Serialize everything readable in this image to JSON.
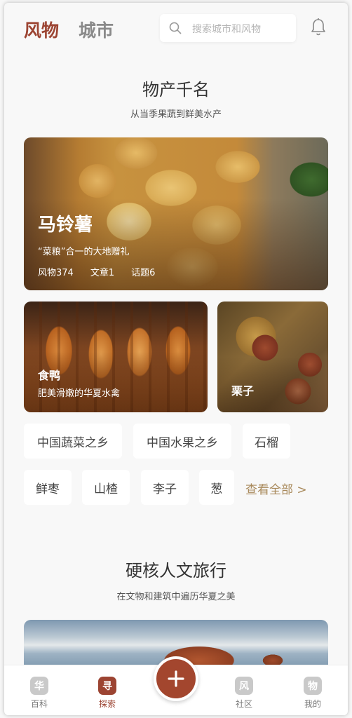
{
  "header": {
    "tab_active": "风物",
    "tab_inactive": "城市",
    "search_placeholder": "搜索城市和风物",
    "icons": {
      "search": "search-icon",
      "notification": "bell-icon"
    }
  },
  "section1": {
    "title": "物产千名",
    "subtitle": "从当季果蔬到鲜美水产",
    "featured": {
      "name": "马铃薯",
      "desc": "“菜粮”合一的大地赠礼",
      "stats": [
        "风物374",
        "文章1",
        "话题6"
      ]
    },
    "cards": [
      {
        "name": "食鸭",
        "desc": "肥美滑嫩的华夏水禽"
      },
      {
        "name": "栗子"
      }
    ],
    "chips_row1": [
      "中国蔬菜之乡",
      "中国水果之乡",
      "石榴"
    ],
    "chips_row2": [
      "鲜枣",
      "山楂",
      "李子",
      "葱"
    ],
    "see_all": "查看全部 >"
  },
  "section2": {
    "title": "硬核人文旅行",
    "subtitle": "在文物和建筑中遍历华夏之美"
  },
  "bottom_nav": {
    "items": [
      {
        "label": "百科",
        "glyph": "华",
        "icon": "baike-icon"
      },
      {
        "label": "探索",
        "glyph": "寻",
        "icon": "explore-icon"
      },
      {
        "label": "社区",
        "glyph": "风",
        "icon": "community-icon"
      },
      {
        "label": "我的",
        "glyph": "物",
        "icon": "profile-icon"
      }
    ],
    "fab_icon": "plus-icon"
  },
  "colors": {
    "accent": "#9c4432",
    "fab": "#a3462e",
    "link": "#a98a5c"
  }
}
